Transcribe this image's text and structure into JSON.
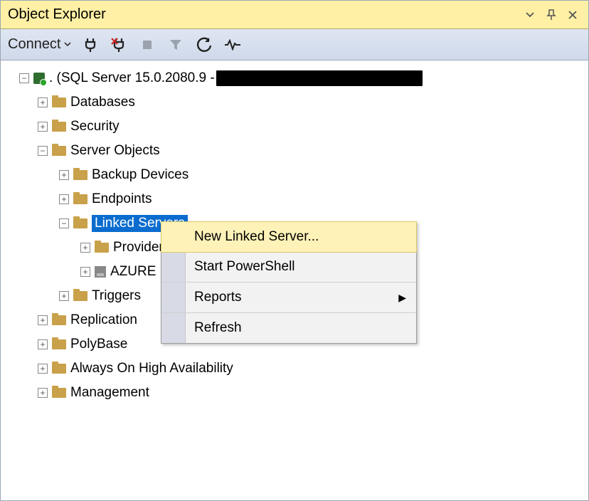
{
  "panel": {
    "title": "Object Explorer"
  },
  "toolbar": {
    "connect_label": "Connect"
  },
  "tree": {
    "root_label": ". (SQL Server 15.0.2080.9 -",
    "databases": "Databases",
    "security": "Security",
    "server_objects": "Server Objects",
    "backup_devices": "Backup Devices",
    "endpoints": "Endpoints",
    "linked_servers": "Linked Servers",
    "providers": "Providers",
    "azure_ls": "AZURE",
    "triggers": "Triggers",
    "replication": "Replication",
    "polybase": "PolyBase",
    "always_on": "Always On High Availability",
    "management": "Management"
  },
  "context_menu": {
    "new_linked_server": "New Linked Server...",
    "start_powershell": "Start PowerShell",
    "reports": "Reports",
    "refresh": "Refresh"
  }
}
